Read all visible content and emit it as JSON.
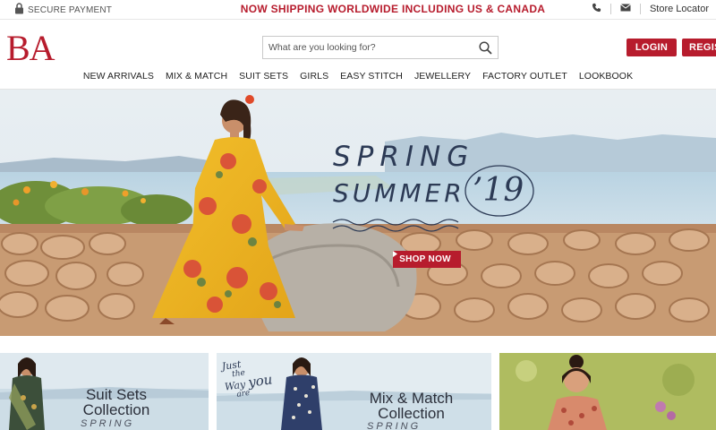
{
  "topbar": {
    "secure_label": "SECURE PAYMENT",
    "promo": "NOW SHIPPING WORLDWIDE INCLUDING US & CANADA",
    "store_locator": "Store Locator",
    "icons": [
      "lock-icon",
      "phone-icon",
      "mail-icon"
    ]
  },
  "header": {
    "logo": "BA",
    "search": {
      "placeholder": "What are you looking for?",
      "value": ""
    },
    "login_label": "LOGIN",
    "register_label": "REGIS"
  },
  "nav": [
    "NEW ARRIVALS",
    "MIX & MATCH",
    "SUIT SETS",
    "GIRLS",
    "EASY STITCH",
    "JEWELLERY",
    "FACTORY OUTLET",
    "LOOKBOOK"
  ],
  "hero": {
    "line1": "SPRING",
    "line2": "SUMMER",
    "year": "’19",
    "cta": "SHOP NOW"
  },
  "tiles": [
    {
      "title1": "Suit Sets",
      "title2": "Collection",
      "sub": "SPRING"
    },
    {
      "script1": "Just",
      "script2": "the",
      "script3": "Way",
      "script4": "you",
      "script5": "are",
      "title1": "Mix & Match",
      "title2": "Collection",
      "sub": "SPRING"
    },
    {
      "title1": "",
      "title2": "",
      "sub": ""
    }
  ],
  "colors": {
    "brand": "#b71c2d",
    "text": "#222222",
    "hero_text": "#2c3a55"
  }
}
